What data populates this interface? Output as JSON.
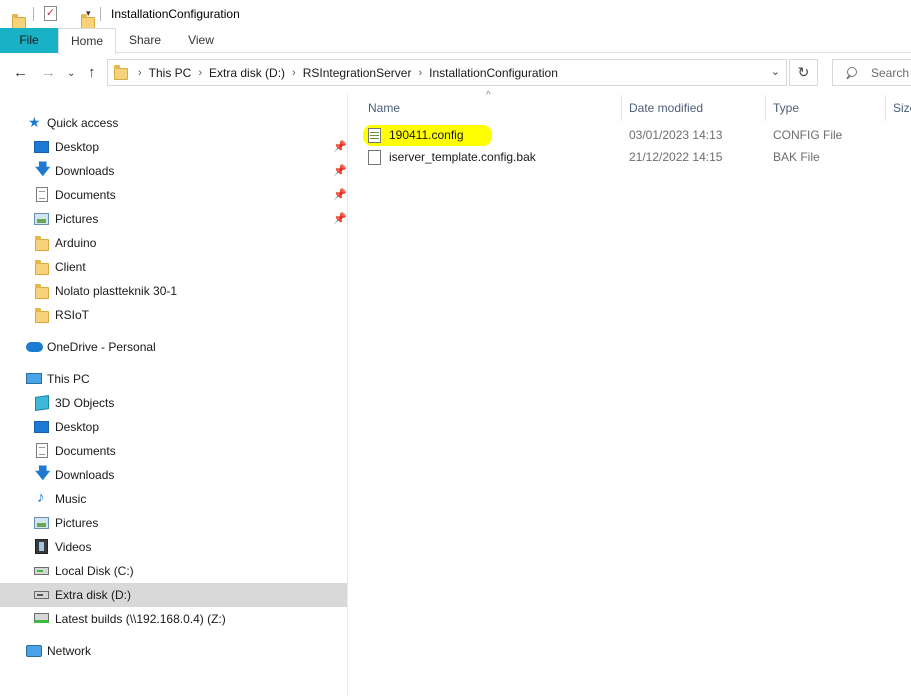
{
  "window": {
    "title": "InstallationConfiguration"
  },
  "ribbon": {
    "tabs": [
      "File",
      "Home",
      "Share",
      "View"
    ]
  },
  "address": {
    "crumbs": [
      "This PC",
      "Extra disk (D:)",
      "RSIntegrationServer",
      "InstallationConfiguration"
    ],
    "search_placeholder": "Search"
  },
  "nav": {
    "quick_access": {
      "label": "Quick access",
      "items": [
        {
          "label": "Desktop",
          "icon": "desktop-icon",
          "pinned": true
        },
        {
          "label": "Downloads",
          "icon": "downloads-icon",
          "pinned": true
        },
        {
          "label": "Documents",
          "icon": "documents-icon",
          "pinned": true
        },
        {
          "label": "Pictures",
          "icon": "pictures-icon",
          "pinned": true
        },
        {
          "label": "Arduino",
          "icon": "folder-icon",
          "pinned": false
        },
        {
          "label": "Client",
          "icon": "folder-icon",
          "pinned": false
        },
        {
          "label": "Nolato plastteknik 30-1",
          "icon": "folder-icon",
          "pinned": false
        },
        {
          "label": "RSIoT",
          "icon": "folder-icon",
          "pinned": false
        }
      ]
    },
    "onedrive": {
      "label": "OneDrive - Personal"
    },
    "this_pc": {
      "label": "This PC",
      "items": [
        {
          "label": "3D Objects",
          "icon": "3d-objects-icon"
        },
        {
          "label": "Desktop",
          "icon": "desktop-icon"
        },
        {
          "label": "Documents",
          "icon": "documents-icon"
        },
        {
          "label": "Downloads",
          "icon": "downloads-icon"
        },
        {
          "label": "Music",
          "icon": "music-icon"
        },
        {
          "label": "Pictures",
          "icon": "pictures-icon"
        },
        {
          "label": "Videos",
          "icon": "videos-icon"
        },
        {
          "label": "Local Disk (C:)",
          "icon": "local-disk-icon"
        },
        {
          "label": "Extra disk (D:)",
          "icon": "disk-icon",
          "selected": true
        },
        {
          "label": "Latest builds (\\\\192.168.0.4) (Z:)",
          "icon": "network-drive-icon"
        }
      ]
    },
    "network": {
      "label": "Network"
    }
  },
  "filelist": {
    "columns": [
      "Name",
      "Date modified",
      "Type",
      "Size"
    ],
    "files": [
      {
        "name": "190411.config",
        "date": "03/01/2023 14:13",
        "type": "CONFIG File",
        "highlighted": true
      },
      {
        "name": "iserver_template.config.bak",
        "date": "21/12/2022 14:15",
        "type": "BAK File",
        "highlighted": false
      }
    ]
  },
  "colors": {
    "file_tab": "#19b1c6",
    "highlight": "#ffff00",
    "selected_row": "#d9d9d9"
  }
}
